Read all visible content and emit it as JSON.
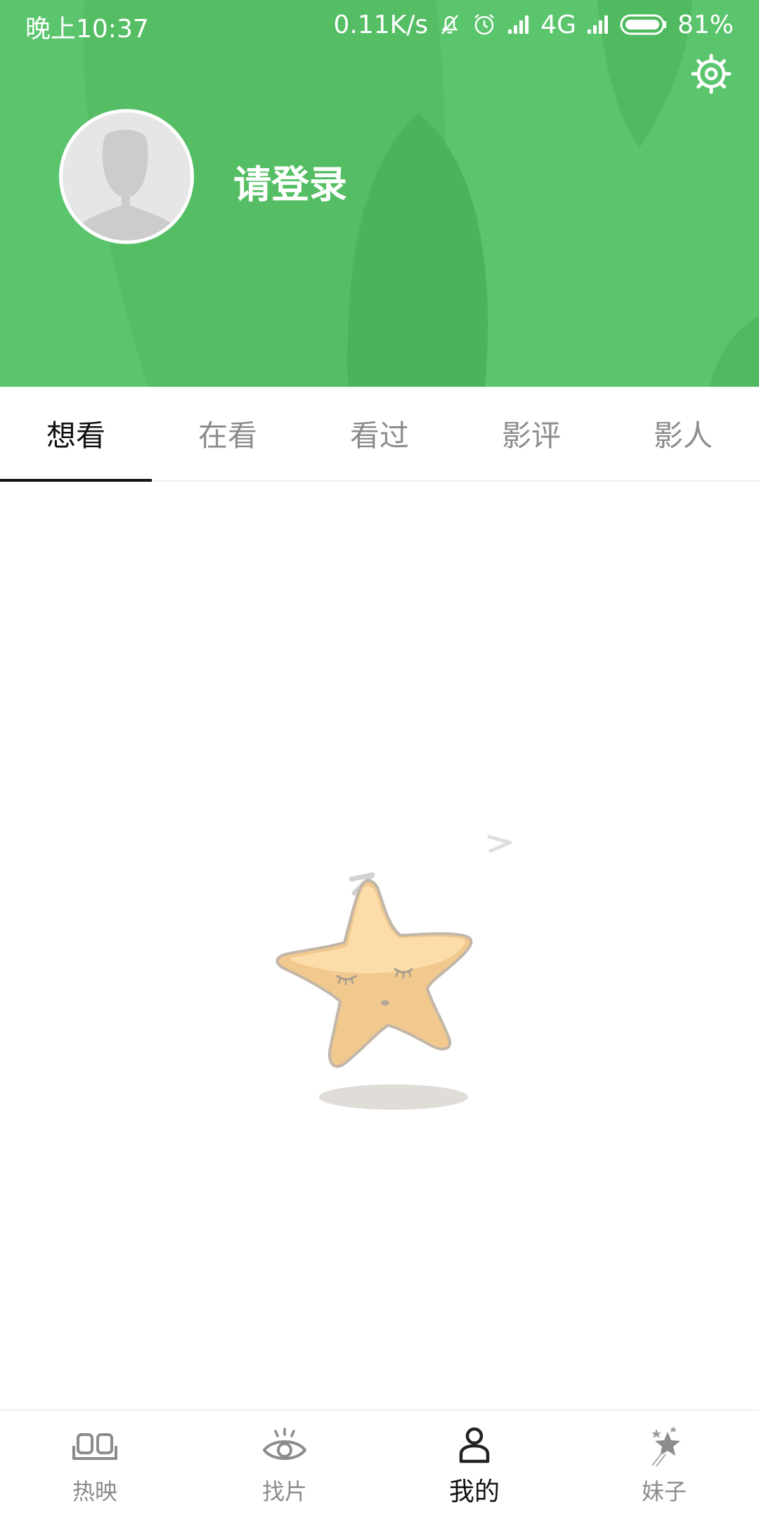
{
  "status_bar": {
    "time": "晚上10:37",
    "net_speed": "0.11K/s",
    "network": "4G",
    "battery": "81%",
    "icons": [
      "mute-bell-icon",
      "alarm-icon",
      "signal-icon",
      "signal-icon",
      "battery-icon"
    ]
  },
  "header": {
    "background_color": "#5ac56c",
    "login_text": "请登录",
    "settings_icon": "gear-icon",
    "avatar_icon": "default-avatar-icon"
  },
  "tabs": {
    "active_index": 0,
    "items": [
      {
        "label": "想看"
      },
      {
        "label": "在看"
      },
      {
        "label": "看过"
      },
      {
        "label": "影评"
      },
      {
        "label": "影人"
      }
    ]
  },
  "empty_state": {
    "icon": "sleeping-star-icon"
  },
  "bottom_nav": {
    "active_index": 2,
    "items": [
      {
        "label": "热映",
        "icon": "cinema-seats-icon"
      },
      {
        "label": "找片",
        "icon": "eye-icon"
      },
      {
        "label": "我的",
        "icon": "person-icon"
      },
      {
        "label": "妹子",
        "icon": "stars-icon"
      }
    ]
  }
}
